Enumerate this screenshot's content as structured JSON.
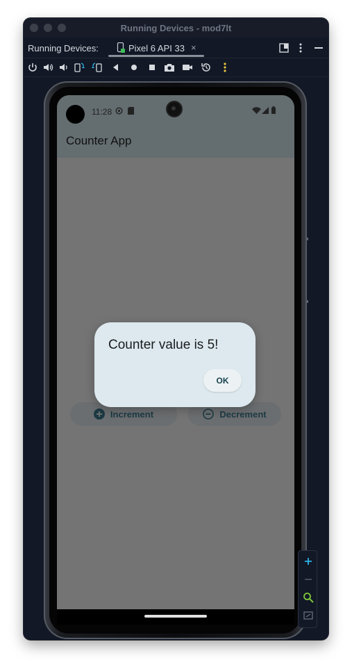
{
  "window": {
    "title": "Running Devices - mod7lt"
  },
  "tabs": {
    "label": "Running Devices:",
    "device_tab": {
      "label": "Pixel 6 API 33",
      "close": "×"
    }
  },
  "toolbar": {
    "icons": [
      "power-icon",
      "volume-up-icon",
      "volume-down-icon",
      "rotate-left-icon",
      "rotate-right-icon",
      "back-icon",
      "home-icon",
      "overview-icon",
      "screenshot-icon",
      "screen-record-icon",
      "snapshot-icon",
      "more-options-icon"
    ]
  },
  "device": {
    "status_time": "11:28",
    "app_title": "Counter App",
    "buttons": {
      "increment": "Increment",
      "decrement": "Decrement"
    },
    "dialog": {
      "message": "Counter value is 5!",
      "ok_label": "OK"
    }
  },
  "zoom": {
    "icons": [
      "zoom-in-icon",
      "zoom-out-icon",
      "zoom-actual-icon",
      "zoom-fit-icon"
    ]
  },
  "colors": {
    "accent": "#2fb4e8",
    "window_bg": "#121826",
    "dialog_bg": "#dde9ef",
    "appbar": "#646d70"
  }
}
